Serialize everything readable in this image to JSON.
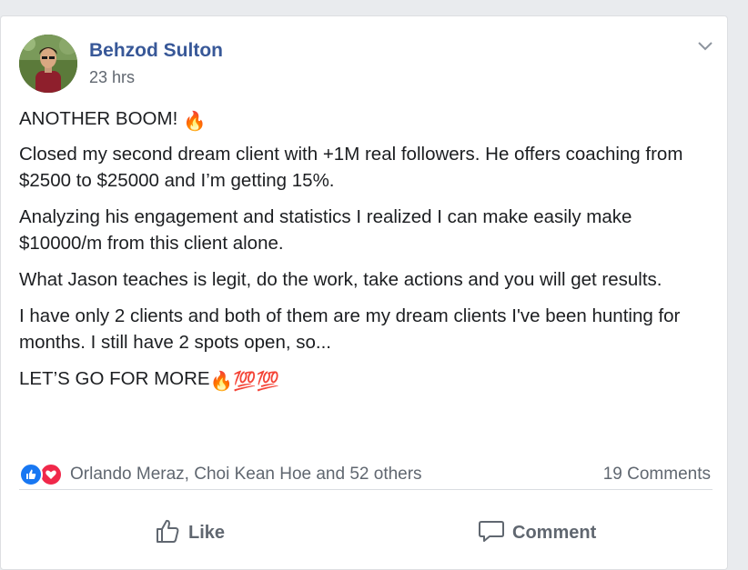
{
  "post": {
    "author": "Behzod Sulton",
    "time": "23 hrs",
    "paragraphs": {
      "p1": "ANOTHER BOOM!",
      "p2": "Closed my second dream client with +1M real followers. He offers coaching from $2500 to $25000 and I’m getting 15%.",
      "p3": "Analyzing his engagement and statistics I realized I can make easily make $10000/m from this client alone.",
      "p4": "What Jason teaches is legit, do the work, take actions and you will get results.",
      "p5": "I have only 2 clients and both of them are my dream clients I've been hunting for months. I still have 2 spots open, so...",
      "p6": "LET’S GO FOR MORE"
    },
    "emoji": {
      "fire": "🔥",
      "hundred": "💯"
    }
  },
  "reactions": {
    "summary": "Orlando Meraz, Choi Kean Hoe and 52 others",
    "comments": "19 Comments",
    "like_color": "#1877f2",
    "love_color": "#f0284a"
  },
  "actions": {
    "like": "Like",
    "comment": "Comment"
  },
  "icons": {
    "avatar": "profile-photo",
    "chevron": "chevron-down-icon",
    "like": "thumbs-up-icon",
    "comment": "speech-bubble-icon"
  }
}
